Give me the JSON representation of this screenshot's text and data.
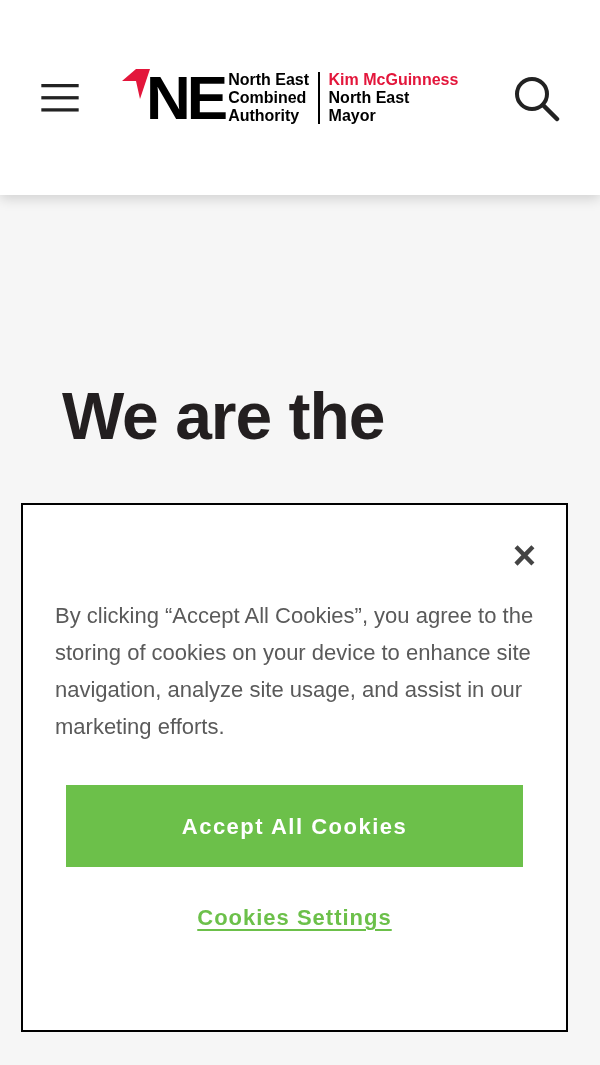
{
  "header": {
    "logo": {
      "letters": "NE",
      "authority_lines": [
        "North East",
        "Combined",
        "Authority"
      ],
      "mayor_name": "Kim McGuinness",
      "mayor_lines": [
        "North East",
        "Mayor"
      ]
    }
  },
  "hero": {
    "heading": "We are the"
  },
  "cookie_banner": {
    "close": "×",
    "message": "By clicking “Accept All Cookies”, you agree to the storing of cookies on your device to enhance site navigation, analyze site usage, and assist in our marketing efforts.",
    "accept_button": "Accept All Cookies",
    "settings_link": "Cookies Settings"
  }
}
